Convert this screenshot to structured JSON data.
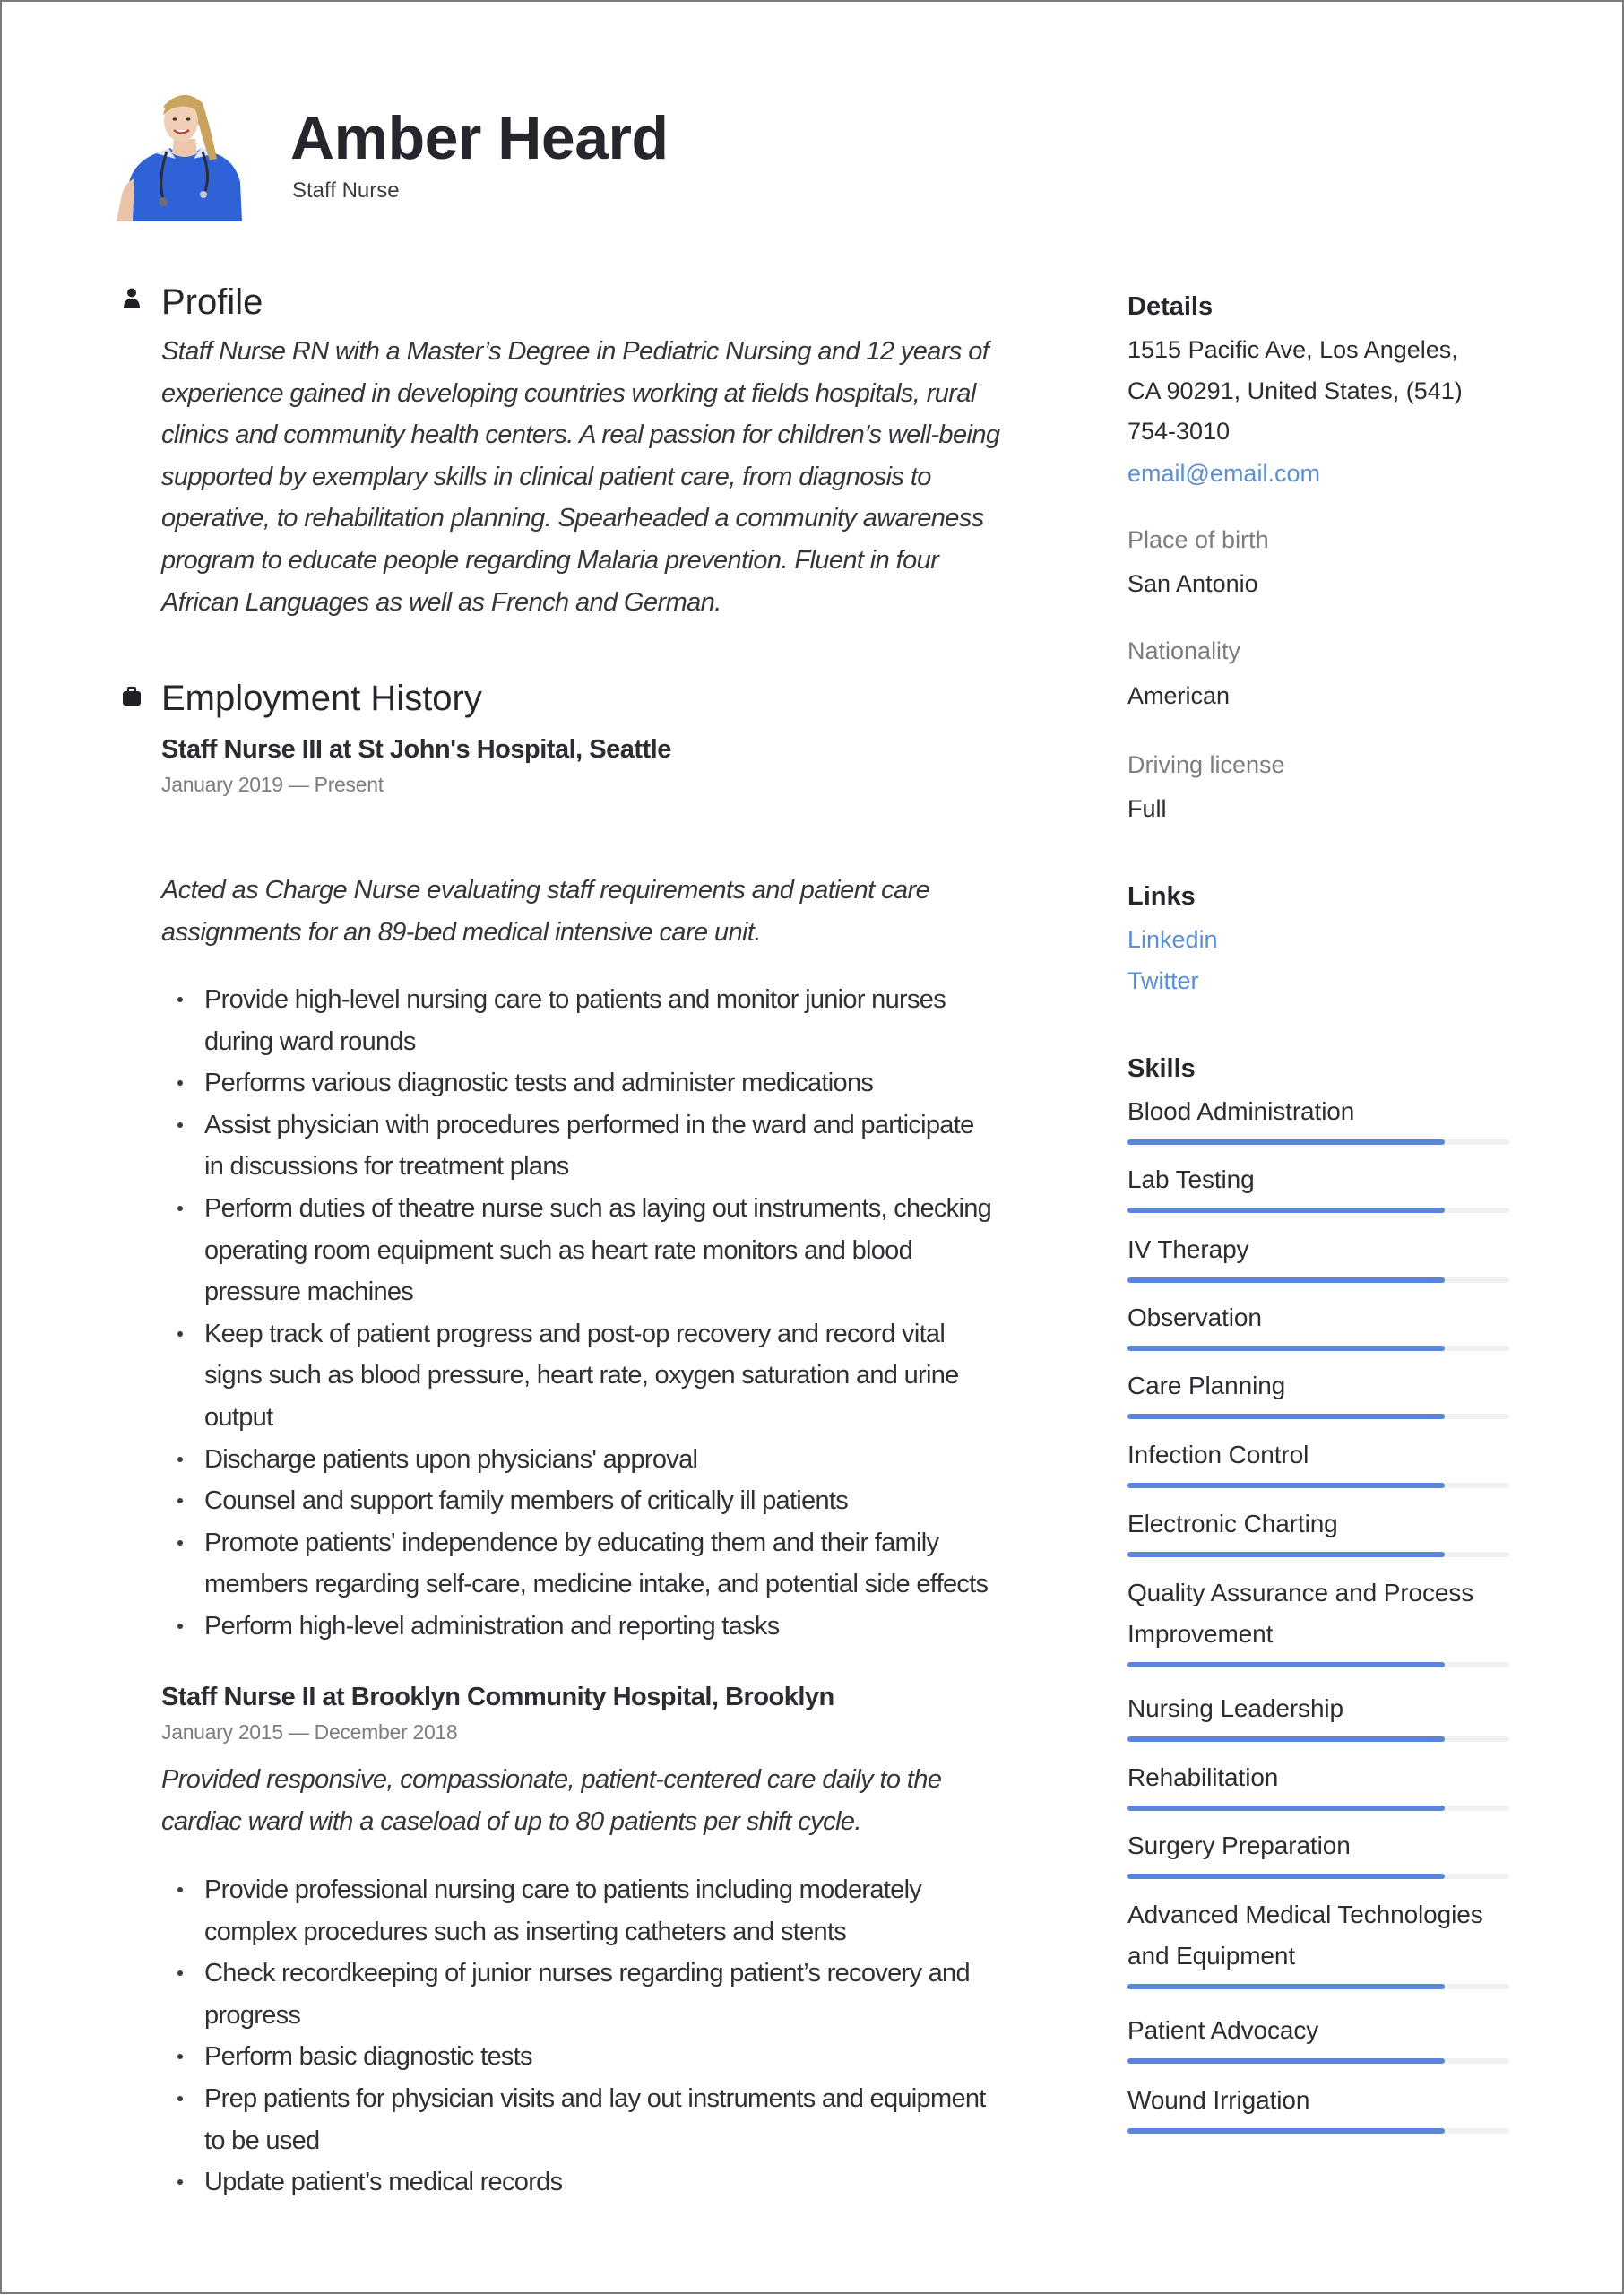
{
  "header": {
    "name": "Amber Heard",
    "job_title": "Staff Nurse",
    "photo_alt": "Portrait of nurse in blue scrubs with stethoscope"
  },
  "profile": {
    "heading": "Profile",
    "icon": "person-icon",
    "lines": [
      "Staff Nurse RN with a Master’s Degree in Pediatric Nursing and 12 years of",
      "experience gained in developing countries working at fields hospitals, rural",
      "clinics and community health centers. A real passion for children’s well-being",
      "supported by exemplary skills in clinical patient care, from diagnosis to",
      "operative, to rehabilitation planning. Spearheaded a community awareness",
      "program to educate people regarding Malaria prevention. Fluent in four",
      "African Languages as well as French and German."
    ]
  },
  "employment": {
    "heading": "Employment History",
    "icon": "briefcase-icon",
    "jobs": [
      {
        "title": "Staff Nurse III at  St John's Hospital, Seattle",
        "dates": "January 2019 — Present",
        "description_lines": [
          "Acted as Charge Nurse evaluating staff requirements and patient care",
          "assignments for an 89-bed medical intensive care unit."
        ],
        "bullets": [
          [
            "Provide high-level nursing care to patients and monitor junior nurses",
            "during ward rounds"
          ],
          [
            "Performs various diagnostic tests and administer medications"
          ],
          [
            "Assist physician with procedures performed in the ward and participate",
            "in discussions for treatment plans"
          ],
          [
            "Perform duties of theatre nurse such as laying out instruments, checking",
            "operating room equipment such as heart rate monitors and blood",
            "pressure machines"
          ],
          [
            "Keep track of patient progress and post-op recovery and record vital",
            "signs such as blood pressure, heart rate, oxygen saturation and urine",
            "output"
          ],
          [
            "Discharge patients upon physicians' approval"
          ],
          [
            "Counsel and support family members of critically ill patients"
          ],
          [
            "Promote patients' independence by educating them and their family",
            "members regarding self-care, medicine intake, and potential side effects"
          ],
          [
            "Perform high-level administration and reporting tasks"
          ]
        ]
      },
      {
        "title": "Staff Nurse II at  Brooklyn Community Hospital, Brooklyn",
        "dates": "January 2015 — December 2018",
        "description_lines": [
          "Provided responsive, compassionate, patient-centered care daily to the",
          "cardiac ward with a caseload of up to 80 patients per shift cycle."
        ],
        "bullets": [
          [
            "Provide professional nursing care to patients including moderately",
            "complex procedures such as inserting catheters and stents"
          ],
          [
            "Check recordkeeping of junior nurses regarding patient’s recovery and",
            "progress"
          ],
          [
            "Perform basic diagnostic tests"
          ],
          [
            "Prep patients for physician visits and lay out instruments and equipment",
            "to be used"
          ],
          [
            "Update patient’s medical records"
          ]
        ]
      }
    ]
  },
  "details": {
    "heading": "Details",
    "address_lines": [
      "1515 Pacific Ave, Los Angeles,",
      "CA 90291, United States, (541)",
      "754-3010"
    ],
    "email": "email@email.com",
    "place_of_birth_label": "Place of birth",
    "place_of_birth": "San Antonio",
    "nationality_label": "Nationality",
    "nationality": "American",
    "driving_license_label": "Driving license",
    "driving_license": "Full"
  },
  "links": {
    "heading": "Links",
    "items": [
      {
        "label": "Linkedin"
      },
      {
        "label": "Twitter"
      }
    ]
  },
  "skills": {
    "heading": "Skills",
    "items": [
      {
        "name": "Blood Administration",
        "level": 0.83
      },
      {
        "name": "Lab Testing",
        "level": 0.83
      },
      {
        "name": "IV Therapy",
        "level": 0.83
      },
      {
        "name": "Observation",
        "level": 0.83
      },
      {
        "name": "Care Planning",
        "level": 0.83
      },
      {
        "name": "Infection Control",
        "level": 0.83
      },
      {
        "name": "Electronic Charting",
        "level": 0.83
      },
      {
        "name": "Quality Assurance and Process Improvement",
        "level": 0.83
      },
      {
        "name": "Nursing Leadership",
        "level": 0.83
      },
      {
        "name": "Rehabilitation",
        "level": 0.83
      },
      {
        "name": "Surgery Preparation",
        "level": 0.83
      },
      {
        "name": "Advanced Medical Technologies and Equipment",
        "level": 0.83
      },
      {
        "name": "Patient Advocacy",
        "level": 0.83
      },
      {
        "name": "Wound Irrigation",
        "level": 0.83
      }
    ]
  },
  "colors": {
    "accent": "#5a86d9",
    "link": "#5b8fd4",
    "track": "#eef0f4",
    "muted_text": "#7b7d82",
    "text": "#2b2d33"
  }
}
